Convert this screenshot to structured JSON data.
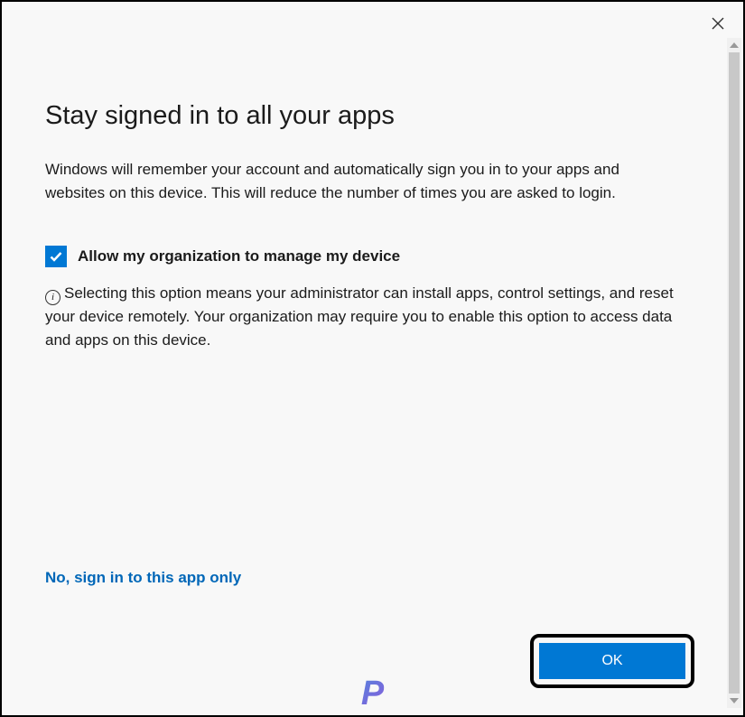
{
  "dialog": {
    "title": "Stay signed in to all your apps",
    "description": "Windows will remember your account and automatically sign you in to your apps and websites on this device. This will reduce the number of times you are asked to login.",
    "checkbox": {
      "checked": true,
      "label": "Allow my organization to manage my device"
    },
    "option_description": "Selecting this option means your administrator can install apps, control settings, and reset your device remotely. Your organization may require you to enable this option to access data and apps on this device.",
    "link_text": "No, sign in to this app only",
    "ok_label": "OK"
  },
  "watermark": "P",
  "colors": {
    "accent": "#0078d4",
    "link": "#0067b8"
  }
}
